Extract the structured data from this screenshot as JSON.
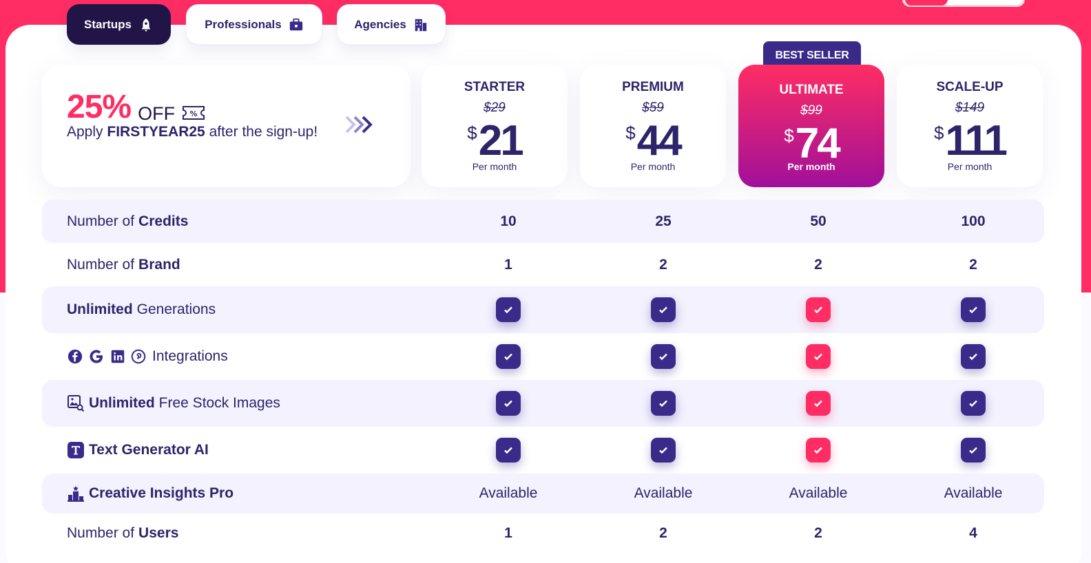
{
  "tabs": [
    {
      "label": "Startups",
      "icon": "rocket-icon",
      "active": true
    },
    {
      "label": "Professionals",
      "icon": "briefcase-icon",
      "active": false
    },
    {
      "label": "Agencies",
      "icon": "building-icon",
      "active": false
    }
  ],
  "promo": {
    "percent": "25%",
    "off": "OFF",
    "apply_prefix": "Apply ",
    "code": "FIRSTYEAR25",
    "apply_suffix": " after the sign-up!"
  },
  "badge": "BEST SELLER",
  "plans": [
    {
      "name": "STARTER",
      "old_price": "$29",
      "currency": "$",
      "price": "21",
      "per": "Per month"
    },
    {
      "name": "PREMIUM",
      "old_price": "$59",
      "currency": "$",
      "price": "44",
      "per": "Per month"
    },
    {
      "name": "ULTIMATE",
      "old_price": "$99",
      "currency": "$",
      "price": "74",
      "per": "Per month"
    },
    {
      "name": "SCALE-UP",
      "old_price": "$149",
      "currency": "$",
      "price": "111",
      "per": "Per month"
    }
  ],
  "rows": {
    "credits": {
      "pre": "Number of ",
      "bold": "Credits",
      "values": [
        "10",
        "25",
        "50",
        "100"
      ]
    },
    "brand": {
      "pre": "Number of ",
      "bold": "Brand",
      "values": [
        "1",
        "2",
        "2",
        "2"
      ]
    },
    "generations": {
      "bold": "Unlimited",
      "post": " Generations"
    },
    "integrations": {
      "post": "Integrations"
    },
    "stock": {
      "bold": "Unlimited",
      "post": " Free Stock Images"
    },
    "textgen": {
      "bold": "Text Generator AI"
    },
    "insights": {
      "bold": "Creative Insights Pro",
      "values": [
        "Available",
        "Available",
        "Available",
        "Available"
      ]
    },
    "users": {
      "pre": "Number of ",
      "bold": "Users",
      "values": [
        "1",
        "2",
        "2",
        "4"
      ]
    }
  },
  "colors": {
    "brand_pink": "#ff2d63",
    "brand_navy": "#211548",
    "check_purple": "#3a2b8a",
    "gradient_end": "#a1109a",
    "stripe": "#f3f2fe"
  }
}
